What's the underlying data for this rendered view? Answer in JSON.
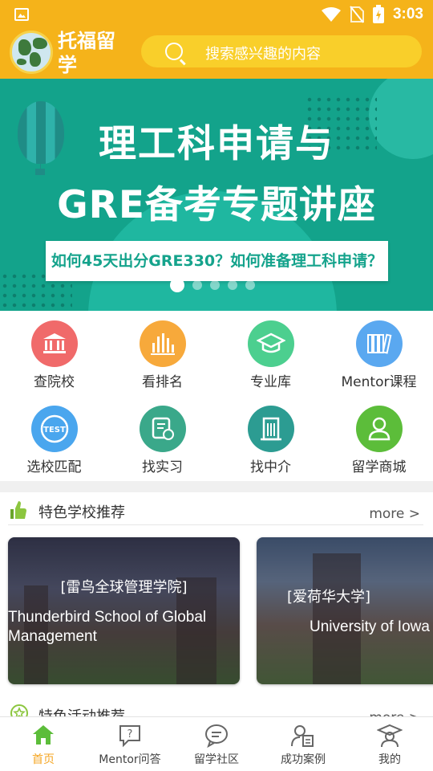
{
  "status_bar": {
    "time": "3:03",
    "icons": [
      "image-icon",
      "wifi-icon",
      "no-sim-icon",
      "battery-charging-icon"
    ]
  },
  "header": {
    "app_title": "托福留学",
    "search_placeholder": "搜索感兴趣的内容"
  },
  "banner": {
    "title_line1": "理工科申请与",
    "title_line2": "GRE备考专题讲座",
    "subtitle": "如何45天出分GRE330？如何准备理工科申请？",
    "page_count": 5,
    "active_page": 1
  },
  "grid": [
    {
      "label": "查院校",
      "icon": "school-building-icon",
      "color": "#f06a6a"
    },
    {
      "label": "看排名",
      "icon": "bar-chart-icon",
      "color": "#f7a93b"
    },
    {
      "label": "专业库",
      "icon": "graduation-cap-icon",
      "color": "#4ccf8f"
    },
    {
      "label": "Mentor课程",
      "icon": "books-icon",
      "color": "#5aa8f0"
    },
    {
      "label": "选校匹配",
      "icon": "test-icon",
      "color": "#4aa6ee"
    },
    {
      "label": "找实习",
      "icon": "resume-icon",
      "color": "#3aa88a"
    },
    {
      "label": "找中介",
      "icon": "office-building-icon",
      "color": "#2c9c92"
    },
    {
      "label": "留学商城",
      "icon": "user-icon",
      "color": "#5cbd3a"
    }
  ],
  "schools_section": {
    "title": "特色学校推荐",
    "more": "more >",
    "cards": [
      {
        "cn": "[雷鸟全球管理学院]",
        "en": "Thunderbird School of Global Management"
      },
      {
        "cn": "[爱荷华大学]",
        "en": "University of Iowa"
      }
    ]
  },
  "activities_section": {
    "title": "特色活动推荐",
    "more": "more >"
  },
  "bottom_nav": [
    {
      "label": "首页",
      "icon": "home-icon",
      "active": true
    },
    {
      "label": "Mentor问答",
      "icon": "question-bubble-icon",
      "active": false
    },
    {
      "label": "留学社区",
      "icon": "chat-bubble-icon",
      "active": false
    },
    {
      "label": "成功案例",
      "icon": "user-document-icon",
      "active": false
    },
    {
      "label": "我的",
      "icon": "graduate-icon",
      "active": false
    }
  ],
  "colors": {
    "brand": "#f5b31a",
    "banner": "#13a38b",
    "active_nav": "#f5a623"
  }
}
